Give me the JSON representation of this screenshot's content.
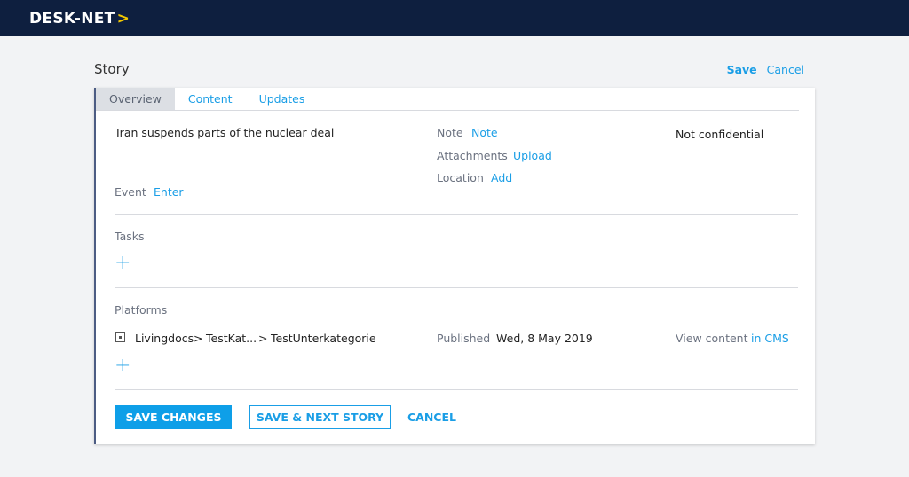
{
  "header": {
    "logo_text": "DESK-NET",
    "logo_arrow": ">"
  },
  "page": {
    "title": "Story",
    "save_label": "Save",
    "cancel_label": "Cancel"
  },
  "tabs": [
    {
      "label": "Overview",
      "active": true
    },
    {
      "label": "Content",
      "active": false
    },
    {
      "label": "Updates",
      "active": false
    }
  ],
  "overview": {
    "headline": "Iran suspends parts of the nuclear deal",
    "note_label": "Note",
    "note_link": "Note",
    "attachments_label": "Attachments",
    "attachments_link": "Upload",
    "location_label": "Location",
    "location_link": "Add",
    "confidentiality": "Not confidential",
    "event_label": "Event",
    "event_link": "Enter"
  },
  "tasks": {
    "label": "Tasks",
    "add_icon": "+"
  },
  "platforms": {
    "label": "Platforms",
    "add_icon": "+",
    "items": [
      {
        "path": [
          "Livingdocs",
          ">",
          "TestKat...",
          ">",
          "TestUnterkategorie"
        ],
        "status_label": "Published",
        "date": "Wed, 8 May 2019",
        "view_label": "View content",
        "view_link": "in CMS"
      }
    ]
  },
  "actions": {
    "save_changes": "SAVE CHANGES",
    "save_next": "SAVE & NEXT STORY",
    "cancel": "CANCEL"
  },
  "colors": {
    "nav_bg": "#0e1f3f",
    "accent": "#1a9ee6",
    "logo_arrow": "#f2c700"
  }
}
